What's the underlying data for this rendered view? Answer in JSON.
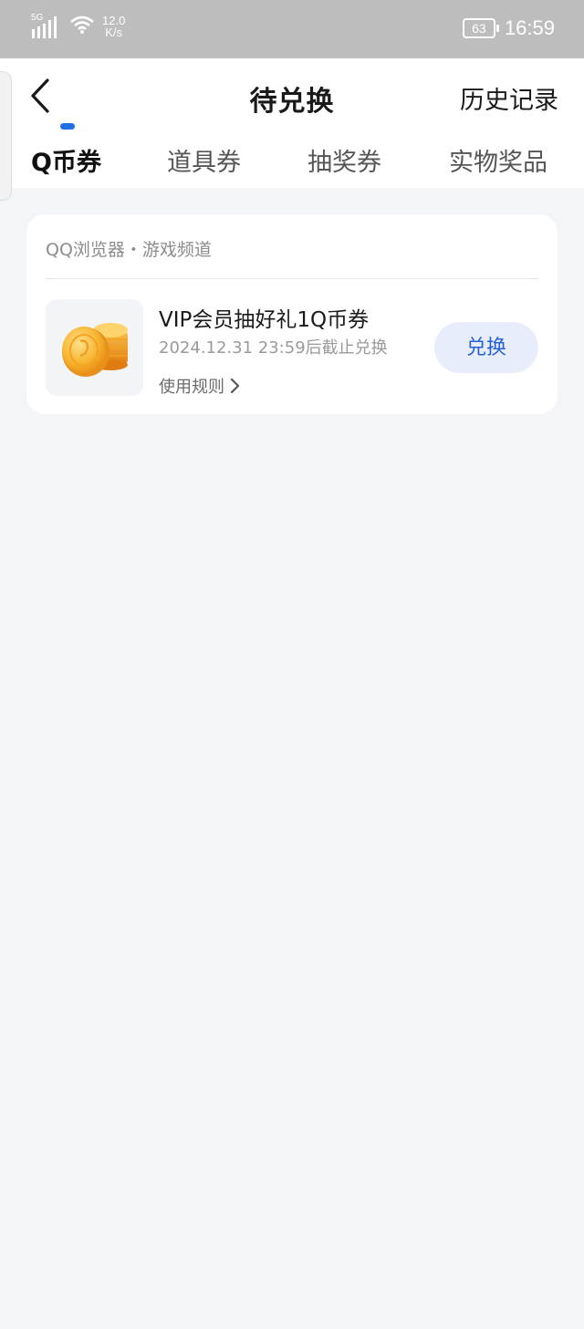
{
  "status_bar": {
    "network": "5G",
    "speed_value": "12.0",
    "speed_unit": "K/s",
    "battery": "63",
    "time": "16:59"
  },
  "header": {
    "title": "待兑换",
    "history_label": "历史记录",
    "back_icon": "chevron-left-icon"
  },
  "tabs": [
    {
      "label": "Q币券",
      "active": true
    },
    {
      "label": "道具券",
      "active": false
    },
    {
      "label": "抽奖券",
      "active": false
    },
    {
      "label": "实物奖品",
      "active": false
    }
  ],
  "card": {
    "source": "QQ浏览器・游戏频道",
    "item_title": "VIP会员抽好礼1Q币券",
    "deadline": "2024.12.31  23:59后截止兑换",
    "rules_label": "使用规则",
    "redeem_label": "兑换",
    "image_icon": "gold-coins-icon"
  },
  "colors": {
    "accent": "#1f6fe5",
    "button_bg": "#e8edfb",
    "button_text": "#2460d8",
    "page_bg": "#f4f5f9",
    "status_bar_bg": "#bdbdbd"
  }
}
